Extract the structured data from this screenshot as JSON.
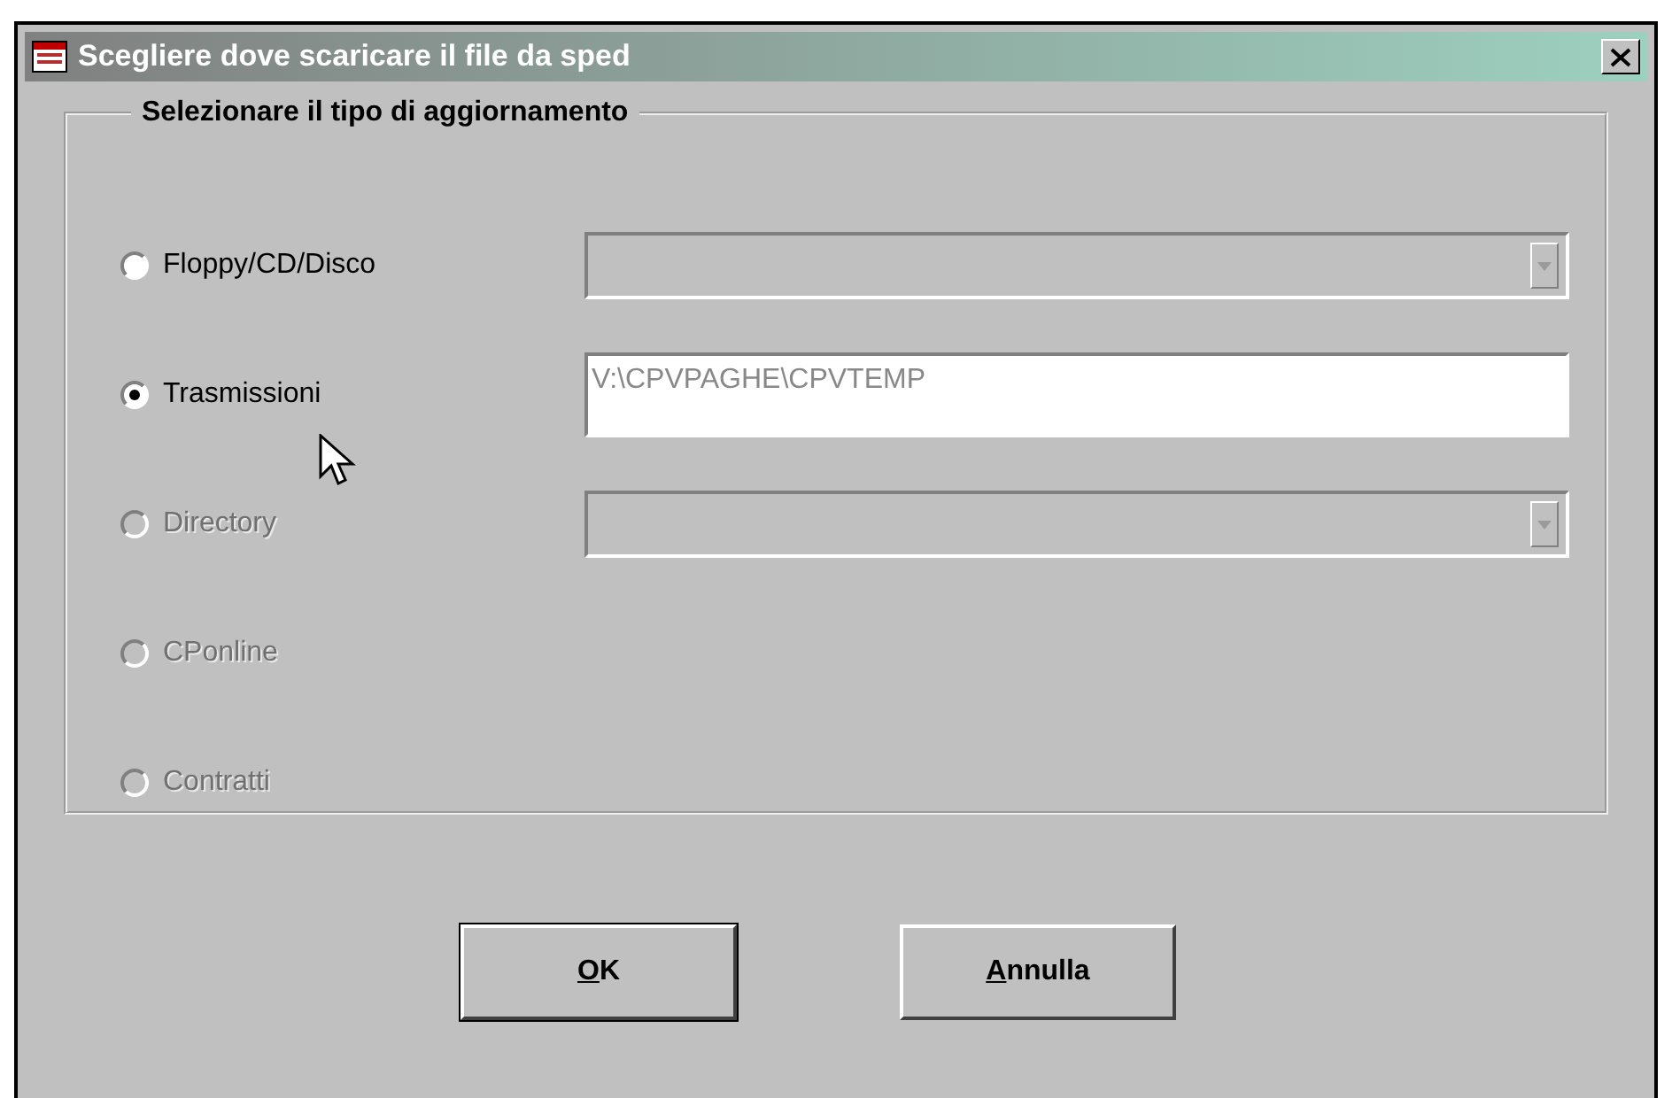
{
  "window": {
    "title": "Scegliere dove scaricare il file da sped"
  },
  "group": {
    "title": "Selezionare il tipo di aggiornamento"
  },
  "options": [
    {
      "label": "Floppy/CD/Disco",
      "selected": false,
      "disabled": false,
      "field": {
        "kind": "combo",
        "disabled": true
      }
    },
    {
      "label": "Trasmissioni",
      "selected": true,
      "disabled": false,
      "field": {
        "kind": "text",
        "value": "V:\\CPVPAGHE\\CPVTEMP"
      }
    },
    {
      "label": "Directory",
      "selected": false,
      "disabled": true,
      "field": {
        "kind": "combo",
        "disabled": true
      }
    },
    {
      "label": "CPonline",
      "selected": false,
      "disabled": true
    },
    {
      "label": "Contratti",
      "selected": false,
      "disabled": true
    }
  ],
  "buttons": [
    {
      "label": "OK",
      "default": true
    },
    {
      "label": "Annulla",
      "default": false
    }
  ]
}
